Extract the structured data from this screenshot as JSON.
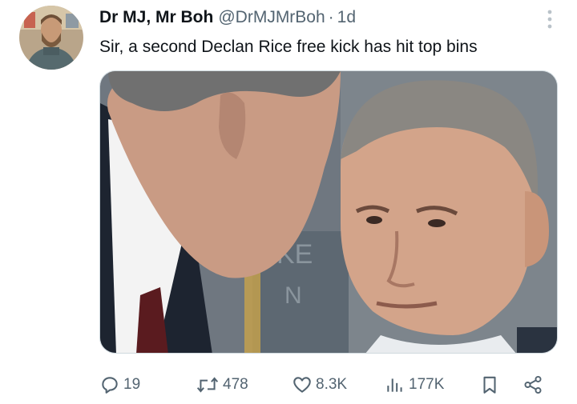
{
  "tweet": {
    "display_name": "Dr MJ, Mr Boh",
    "handle": "@DrMJMrBoh",
    "separator": "·",
    "time": "1d",
    "text": "Sir, a second Declan Rice free kick has hit top bins",
    "avatar_icon": "profile-photo",
    "media_description": "photo"
  },
  "actions": {
    "replies": "19",
    "retweets": "478",
    "likes": "8.3K",
    "views": "177K",
    "icons": [
      "reply-icon",
      "retweet-icon",
      "like-icon",
      "views-icon",
      "bookmark-icon",
      "share-icon"
    ]
  },
  "colors": {
    "text": "#0f1419",
    "secondary": "#536471",
    "border": "#cfd9de"
  }
}
